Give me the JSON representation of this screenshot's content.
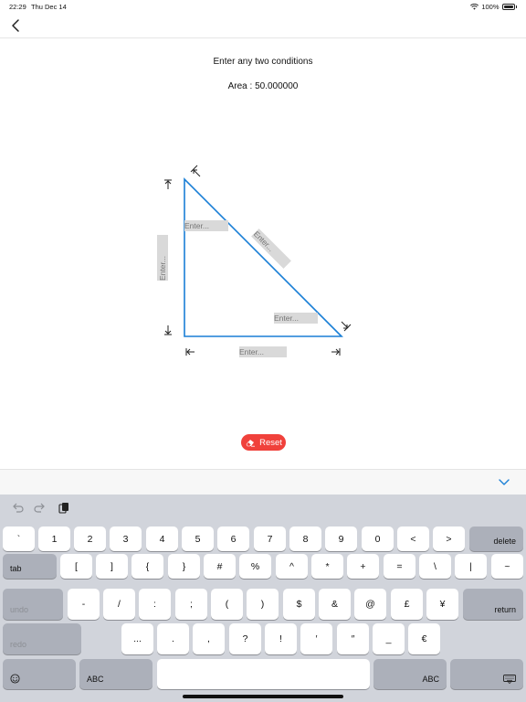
{
  "status": {
    "time": "22:29",
    "date": "Thu Dec 14",
    "battery": "100%"
  },
  "main": {
    "instruction": "Enter any two conditions",
    "area_label": "Area",
    "area_sep": ":",
    "area_value": "50.000000"
  },
  "fields": {
    "top_angle_placeholder": "Enter...",
    "bottom_angle_placeholder": "Enter...",
    "base_placeholder": "Enter...",
    "height_placeholder": "Enter...",
    "hypotenuse_placeholder": "Enter..."
  },
  "colors": {
    "triangle_stroke": "#1a7fd6",
    "reset_bg": "#f0413b",
    "chevron": "#1a7fd6"
  },
  "reset_label": "Reset",
  "keyboard": {
    "row1": [
      "`",
      "1",
      "2",
      "3",
      "4",
      "5",
      "6",
      "7",
      "8",
      "9",
      "0",
      "<",
      ">"
    ],
    "delete": "delete",
    "tab": "tab",
    "row2": [
      "[",
      "]",
      "{",
      "}",
      "#",
      "%",
      "^",
      "*",
      "+",
      "=",
      "\\",
      "|",
      "~"
    ],
    "undo": "undo",
    "row3": [
      "-",
      "/",
      ":",
      ";",
      "(",
      ")",
      "$",
      "&",
      "@",
      "£",
      "¥"
    ],
    "return": "return",
    "redo": "redo",
    "row4": [
      "...",
      ".",
      ",",
      "?",
      "!",
      "′",
      "″",
      "_",
      "€"
    ],
    "abc_left": "ABC",
    "abc_right": "ABC"
  }
}
